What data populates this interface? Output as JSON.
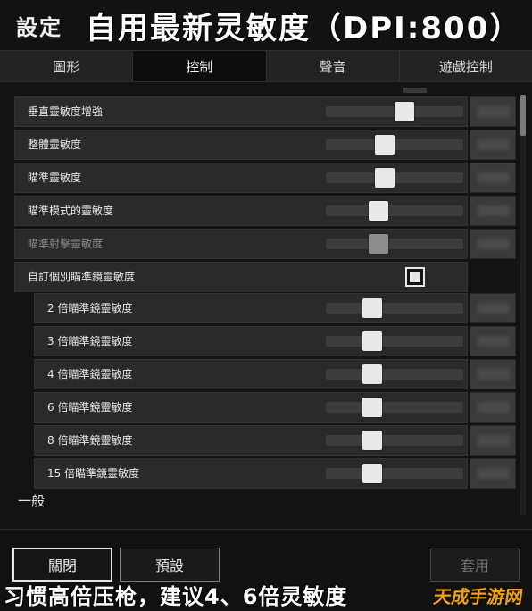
{
  "header": {
    "settings_label": "設定",
    "overlay_title": "自用最新灵敏度（DPI:800）"
  },
  "tabs": [
    {
      "label": "圖形",
      "active": false
    },
    {
      "label": "控制",
      "active": true
    },
    {
      "label": "聲音",
      "active": false
    },
    {
      "label": "遊戲控制",
      "active": false
    }
  ],
  "rows": [
    {
      "label": "垂直靈敏度增強",
      "slider_value": 0.58,
      "dim": false
    },
    {
      "label": "整體靈敏度",
      "slider_value": 0.42,
      "dim": false
    },
    {
      "label": "瞄準靈敏度",
      "slider_value": 0.42,
      "dim": false
    },
    {
      "label": "瞄準模式的靈敏度",
      "slider_value": 0.36,
      "dim": false
    },
    {
      "label": "瞄準射擊靈敏度",
      "slider_value": 0.36,
      "dim": true
    },
    {
      "label": "自訂個別瞄準鏡靈敏度",
      "checkbox_checked": true
    },
    {
      "label": "2 倍瞄準鏡靈敏度",
      "slider_value": 0.31,
      "dim": false
    },
    {
      "label": "3 倍瞄準鏡靈敏度",
      "slider_value": 0.31,
      "dim": false
    },
    {
      "label": "4 倍瞄準鏡靈敏度",
      "slider_value": 0.31,
      "dim": false
    },
    {
      "label": "6 倍瞄準鏡靈敏度",
      "slider_value": 0.31,
      "dim": false
    },
    {
      "label": "8 倍瞄準鏡靈敏度",
      "slider_value": 0.31,
      "dim": false
    },
    {
      "label": "15 倍瞄準鏡靈敏度",
      "slider_value": 0.31,
      "dim": false
    }
  ],
  "section_general": "一般",
  "footer": {
    "close_label": "關閉",
    "default_label": "預設",
    "apply_label": "套用"
  },
  "caption": "习惯高倍压枪，建议4、6倍灵敏度",
  "watermark": "天成手游网",
  "colors": {
    "background": "#141414",
    "row_bg": "#2a2a2a",
    "slider_thumb": "#e9e9e9",
    "watermark": "#f4a300"
  }
}
